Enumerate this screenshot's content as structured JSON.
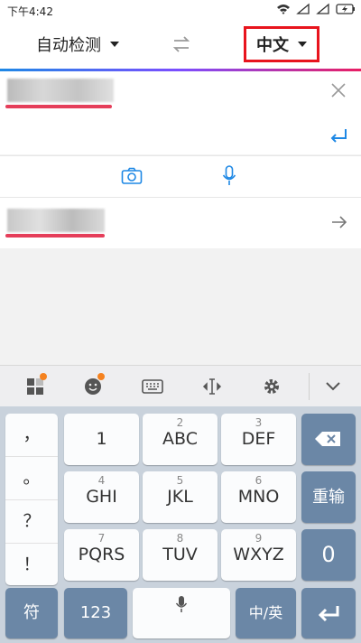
{
  "status": {
    "time": "下午4:42"
  },
  "header": {
    "source_lang": "自动检测",
    "target_lang": "中文"
  },
  "keyboard": {
    "punctuation": [
      "，",
      "。",
      "？",
      "！"
    ],
    "rows": [
      [
        {
          "num": "",
          "label": "1"
        },
        {
          "num": "2",
          "label": "ABC"
        },
        {
          "num": "3",
          "label": "DEF"
        }
      ],
      [
        {
          "num": "4",
          "label": "GHI"
        },
        {
          "num": "5",
          "label": "JKL"
        },
        {
          "num": "6",
          "label": "MNO"
        }
      ],
      [
        {
          "num": "7",
          "label": "PQRS"
        },
        {
          "num": "8",
          "label": "TUV"
        },
        {
          "num": "9",
          "label": "WXYZ"
        }
      ]
    ],
    "reenter_label": "重输",
    "zero_label": "0",
    "symbols_label": "符",
    "numbers_label": "123",
    "lang_switch_label": "中/英"
  },
  "colors": {
    "accent_blue": "#1e88e5",
    "highlight_red": "#e8141d",
    "key_dark": "#6b87a6"
  }
}
